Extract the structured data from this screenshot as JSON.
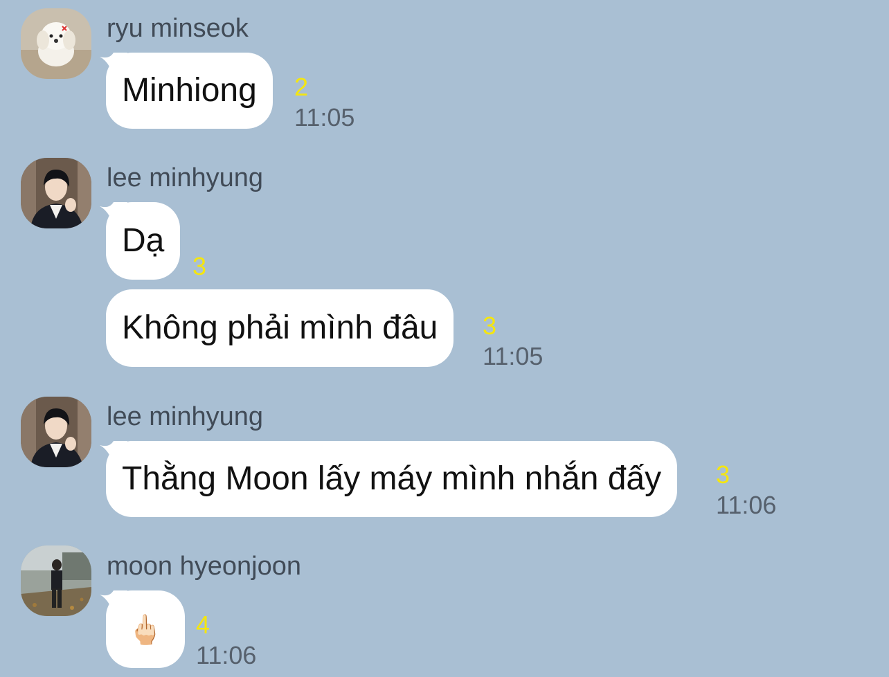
{
  "messages": [
    {
      "sender": "ryu minseok",
      "avatar": "white-puppy-avatar",
      "text": "Minhiong",
      "unread": "2",
      "time": "11:05"
    },
    {
      "sender": "lee minhyung",
      "avatar": "lee-minhyung-avatar",
      "text": "Dạ",
      "unread": "3",
      "time": ""
    },
    {
      "sender": "",
      "avatar": "",
      "text": "Không phải mình đâu",
      "unread": "3",
      "time": "11:05"
    },
    {
      "sender": "lee minhyung",
      "avatar": "lee-minhyung-avatar",
      "text": "Thằng Moon lấy máy mình nhắn đấy",
      "unread": "3",
      "time": "11:06"
    },
    {
      "sender": "moon hyeonjoon",
      "avatar": "moon-hyeonjoon-avatar",
      "text": "🖕🏻",
      "unread": "4",
      "time": "11:06"
    }
  ],
  "colors": {
    "background": "#a9bfd3",
    "bubble": "#ffffff",
    "unread": "#f5e60f",
    "time": "#56606c",
    "sender": "#414b57"
  }
}
